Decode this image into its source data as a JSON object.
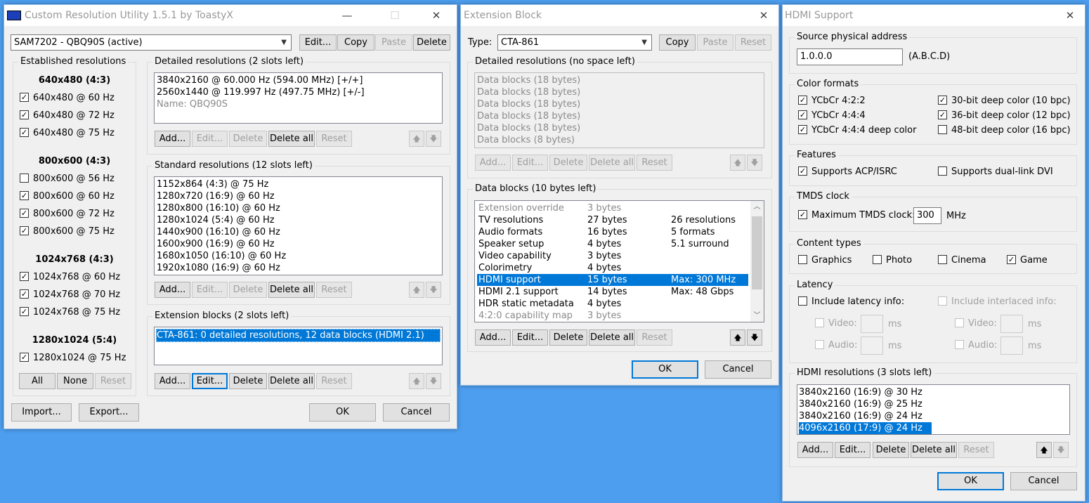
{
  "cru": {
    "title": "Custom Resolution Utility 1.5.1 by ToastyX",
    "monitor_select": "SAM7202 - QBQ90S (active)",
    "buttons": {
      "edit": "Edit...",
      "copy": "Copy",
      "paste": "Paste",
      "delete": "Delete"
    },
    "established": {
      "label": "Established resolutions",
      "groups": [
        {
          "title": "640x480 (4:3)",
          "items": [
            {
              "label": "640x480 @ 60 Hz",
              "checked": true
            },
            {
              "label": "640x480 @ 72 Hz",
              "checked": true
            },
            {
              "label": "640x480 @ 75 Hz",
              "checked": true
            }
          ]
        },
        {
          "title": "800x600 (4:3)",
          "items": [
            {
              "label": "800x600 @ 56 Hz",
              "checked": false
            },
            {
              "label": "800x600 @ 60 Hz",
              "checked": true
            },
            {
              "label": "800x600 @ 72 Hz",
              "checked": true
            },
            {
              "label": "800x600 @ 75 Hz",
              "checked": true
            }
          ]
        },
        {
          "title": "1024x768 (4:3)",
          "items": [
            {
              "label": "1024x768 @ 60 Hz",
              "checked": true
            },
            {
              "label": "1024x768 @ 70 Hz",
              "checked": true
            },
            {
              "label": "1024x768 @ 75 Hz",
              "checked": true
            }
          ]
        },
        {
          "title": "1280x1024 (5:4)",
          "items": [
            {
              "label": "1280x1024 @ 75 Hz",
              "checked": true
            }
          ]
        }
      ],
      "all": "All",
      "none": "None",
      "reset": "Reset"
    },
    "detailed": {
      "label": "Detailed resolutions (2 slots left)",
      "rows": [
        "3840x2160 @ 60.000 Hz (594.00 MHz) [+/+]",
        "2560x1440 @ 119.997 Hz (497.75 MHz) [+/-]",
        "Name: QBQ90S"
      ]
    },
    "standard": {
      "label": "Standard resolutions (12 slots left)",
      "rows": [
        "1152x864 (4:3) @ 75 Hz",
        "1280x720 (16:9) @ 60 Hz",
        "1280x800 (16:10) @ 60 Hz",
        "1280x1024 (5:4) @ 60 Hz",
        "1440x900 (16:10) @ 60 Hz",
        "1600x900 (16:9) @ 60 Hz",
        "1680x1050 (16:10) @ 60 Hz",
        "1920x1080 (16:9) @ 60 Hz"
      ]
    },
    "extension": {
      "label": "Extension blocks (2 slots left)",
      "rows": [
        "CTA-861: 0 detailed resolutions, 12 data blocks (HDMI 2.1)"
      ]
    },
    "list_buttons": {
      "add": "Add...",
      "edit": "Edit...",
      "delete": "Delete",
      "delete_all": "Delete all",
      "reset": "Reset"
    },
    "arrows": {
      "up": "🡅",
      "down": "🡇"
    },
    "import": "Import...",
    "export": "Export...",
    "ok": "OK",
    "cancel": "Cancel"
  },
  "ext": {
    "title": "Extension Block",
    "type_label": "Type:",
    "type_value": "CTA-861",
    "copy": "Copy",
    "paste": "Paste",
    "reset": "Reset",
    "detailed_label": "Detailed resolutions (no space left)",
    "detailed_rows": [
      "Data blocks (18 bytes)",
      "Data blocks (18 bytes)",
      "Data blocks (18 bytes)",
      "Data blocks (18 bytes)",
      "Data blocks (18 bytes)",
      "Data blocks (8 bytes)"
    ],
    "datablocks_label": "Data blocks (10 bytes left)",
    "datablocks": [
      {
        "name": "Extension override",
        "size": "3 bytes",
        "info": "",
        "gray": true
      },
      {
        "name": "TV resolutions",
        "size": "27 bytes",
        "info": "26 resolutions"
      },
      {
        "name": "Audio formats",
        "size": "16 bytes",
        "info": "5 formats"
      },
      {
        "name": "Speaker setup",
        "size": "4 bytes",
        "info": "5.1 surround"
      },
      {
        "name": "Video capability",
        "size": "3 bytes",
        "info": ""
      },
      {
        "name": "Colorimetry",
        "size": "4 bytes",
        "info": ""
      },
      {
        "name": "HDMI support",
        "size": "15 bytes",
        "info": "Max: 300 MHz",
        "selected": true
      },
      {
        "name": "HDMI 2.1 support",
        "size": "14 bytes",
        "info": "Max: 48 Gbps"
      },
      {
        "name": "HDR static metadata",
        "size": "4 bytes",
        "info": ""
      },
      {
        "name": "4:2:0 capability map",
        "size": "3 bytes",
        "info": "",
        "gray": true
      }
    ],
    "ok": "OK",
    "cancel": "Cancel"
  },
  "hdmi": {
    "title": "HDMI Support",
    "source_label": "Source physical address",
    "source_value": "1.0.0.0",
    "source_hint": "(A.B.C.D)",
    "color_label": "Color formats",
    "color_left": [
      {
        "label": "YCbCr 4:2:2",
        "checked": true
      },
      {
        "label": "YCbCr 4:4:4",
        "checked": true
      },
      {
        "label": "YCbCr 4:4:4 deep color",
        "checked": true
      }
    ],
    "color_right": [
      {
        "label": "30-bit deep color (10 bpc)",
        "checked": true
      },
      {
        "label": "36-bit deep color (12 bpc)",
        "checked": true
      },
      {
        "label": "48-bit deep color (16 bpc)",
        "checked": false
      }
    ],
    "features_label": "Features",
    "acp": "Supports ACP/ISRC",
    "duallink": "Supports dual-link DVI",
    "tmds_label": "TMDS clock",
    "tmds_check": "Maximum TMDS clock:",
    "tmds_value": "300",
    "tmds_unit": "MHz",
    "content_label": "Content types",
    "content": [
      {
        "label": "Graphics",
        "checked": false
      },
      {
        "label": "Photo",
        "checked": false
      },
      {
        "label": "Cinema",
        "checked": false
      },
      {
        "label": "Game",
        "checked": true
      }
    ],
    "latency_label": "Latency",
    "lat_incl": "Include latency info:",
    "lat_incl_int": "Include interlaced info:",
    "video": "Video:",
    "audio": "Audio:",
    "ms": "ms",
    "res_label": "HDMI resolutions (3 slots left)",
    "res_rows": [
      "3840x2160 (16:9) @ 30 Hz",
      "3840x2160 (16:9) @ 25 Hz",
      "3840x2160 (16:9) @ 24 Hz",
      "4096x2160 (17:9) @ 24 Hz"
    ],
    "ok": "OK",
    "cancel": "Cancel"
  },
  "check_mark": "✓",
  "close": "✕",
  "max": "☐",
  "min": "—"
}
